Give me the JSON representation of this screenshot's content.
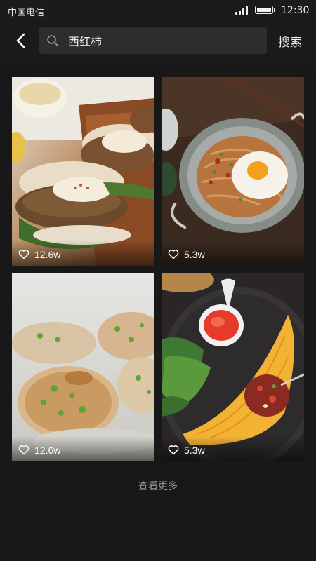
{
  "status_bar": {
    "carrier": "中国电信",
    "time": "12:30",
    "battery_level": 0.9,
    "signal_bars": 4
  },
  "header": {
    "back_icon": "chevron-left-icon",
    "search_icon": "search-icon",
    "search_value": "西红柿",
    "search_button": "搜索"
  },
  "results": [
    {
      "dish": "falafel pita sandwiches",
      "likes": "12.6w",
      "icon": "heart-outline-icon"
    },
    {
      "dish": "noodles with fried egg",
      "likes": "5.3w",
      "icon": "heart-outline-icon"
    },
    {
      "dish": "scallion rice cakes",
      "likes": "12.6w",
      "icon": "heart-outline-icon"
    },
    {
      "dish": "omelette wrap with chili sauce",
      "likes": "5.3w",
      "icon": "heart-outline-icon"
    }
  ],
  "load_more": "查看更多",
  "colors": {
    "background": "#181818",
    "search_box": "#2d2d2d",
    "muted_text": "#9a9a9a"
  }
}
